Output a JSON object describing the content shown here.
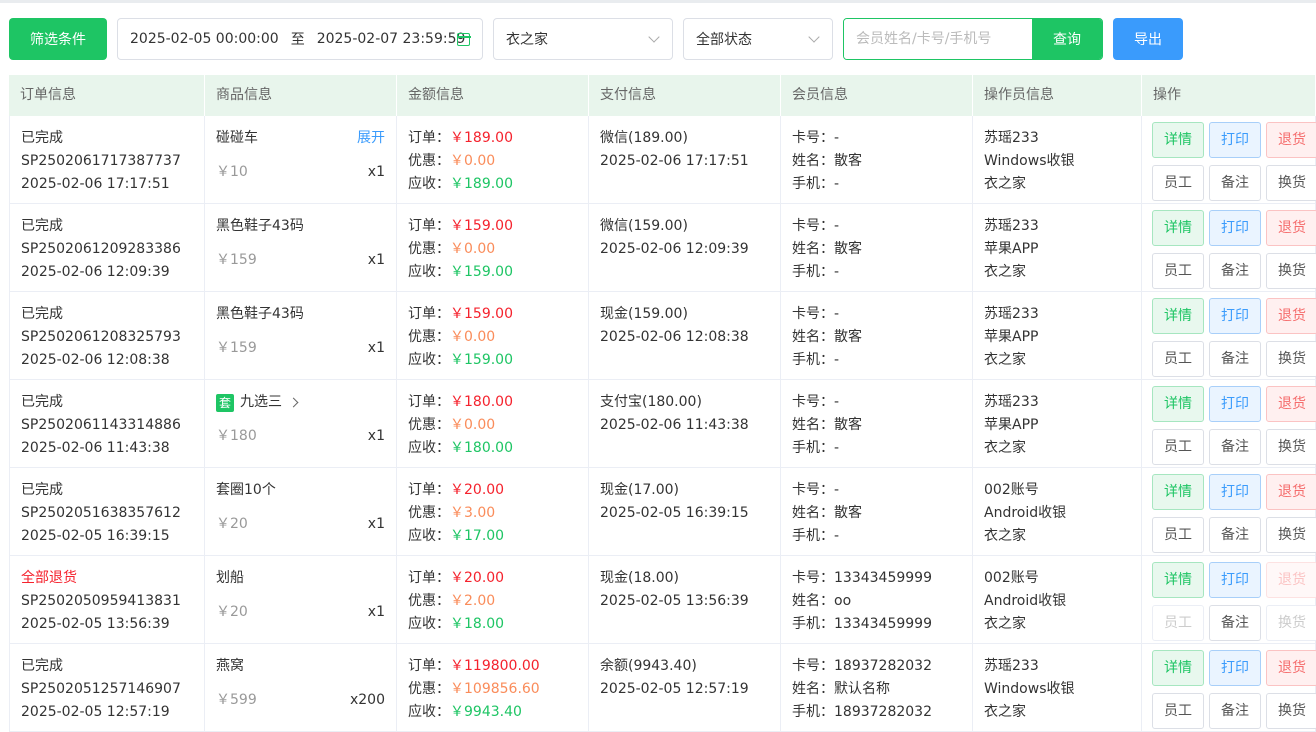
{
  "toolbar": {
    "filter_label": "筛选条件",
    "date_start": "2025-02-05 00:00:00",
    "date_sep": "至",
    "date_end": "2025-02-07 23:59:59",
    "store_value": "衣之家",
    "status_value": "全部状态",
    "search_placeholder": "会员姓名/卡号/手机号",
    "query_label": "查询",
    "export_label": "导出"
  },
  "table": {
    "headers": [
      "订单信息",
      "商品信息",
      "金额信息",
      "支付信息",
      "会员信息",
      "操作员信息",
      "操作"
    ],
    "labels": {
      "order": "订单：",
      "discount": "优惠：",
      "receivable": "应收：",
      "card": "卡号：",
      "name": "姓名：",
      "phone": "手机：",
      "expand": "展开",
      "set_tag": "套",
      "op_detail": "详情",
      "op_print": "打印",
      "op_refund": "退货",
      "op_staff": "员工",
      "op_note": "备注",
      "op_exchange": "换货"
    },
    "rows": [
      {
        "status": "已完成",
        "order_no": "SP2502061717387737",
        "time": "2025-02-06 17:17:51",
        "goods": "碰碰车",
        "price": "￥10",
        "qty": "x1",
        "order_amt": "￥189.00",
        "discount_amt": "￥0.00",
        "recv_amt": "￥189.00",
        "pay_method": "微信(189.00)",
        "pay_time": "2025-02-06 17:17:51",
        "card": "-",
        "name": "散客",
        "phone": "-",
        "operator": "苏瑶233",
        "terminal": "Windows收银",
        "store": "衣之家"
      },
      {
        "status": "已完成",
        "order_no": "SP2502061209283386",
        "time": "2025-02-06 12:09:39",
        "goods": "黑色鞋子43码",
        "price": "￥159",
        "qty": "x1",
        "order_amt": "￥159.00",
        "discount_amt": "￥0.00",
        "recv_amt": "￥159.00",
        "pay_method": "微信(159.00)",
        "pay_time": "2025-02-06 12:09:39",
        "card": "-",
        "name": "散客",
        "phone": "-",
        "operator": "苏瑶233",
        "terminal": "苹果APP",
        "store": "衣之家"
      },
      {
        "status": "已完成",
        "order_no": "SP2502061208325793",
        "time": "2025-02-06 12:08:38",
        "goods": "黑色鞋子43码",
        "price": "￥159",
        "qty": "x1",
        "order_amt": "￥159.00",
        "discount_amt": "￥0.00",
        "recv_amt": "￥159.00",
        "pay_method": "现金(159.00)",
        "pay_time": "2025-02-06 12:08:38",
        "card": "-",
        "name": "散客",
        "phone": "-",
        "operator": "苏瑶233",
        "terminal": "苹果APP",
        "store": "衣之家"
      },
      {
        "status": "已完成",
        "order_no": "SP2502061143314886",
        "time": "2025-02-06 11:43:38",
        "goods": "九选三",
        "price": "￥180",
        "qty": "x1",
        "order_amt": "￥180.00",
        "discount_amt": "￥0.00",
        "recv_amt": "￥180.00",
        "pay_method": "支付宝(180.00)",
        "pay_time": "2025-02-06 11:43:38",
        "card": "-",
        "name": "散客",
        "phone": "-",
        "operator": "苏瑶233",
        "terminal": "苹果APP",
        "store": "衣之家"
      },
      {
        "status": "已完成",
        "order_no": "SP2502051638357612",
        "time": "2025-02-05 16:39:15",
        "goods": "套圈10个",
        "price": "￥20",
        "qty": "x1",
        "order_amt": "￥20.00",
        "discount_amt": "￥3.00",
        "recv_amt": "￥17.00",
        "pay_method": "现金(17.00)",
        "pay_time": "2025-02-05 16:39:15",
        "card": "-",
        "name": "散客",
        "phone": "-",
        "operator": "002账号",
        "terminal": "Android收银",
        "store": "衣之家"
      },
      {
        "status": "全部退货",
        "order_no": "SP2502050959413831",
        "time": "2025-02-05 13:56:39",
        "goods": "划船",
        "price": "￥20",
        "qty": "x1",
        "order_amt": "￥20.00",
        "discount_amt": "￥2.00",
        "recv_amt": "￥18.00",
        "pay_method": "现金(18.00)",
        "pay_time": "2025-02-05 13:56:39",
        "card": "13343459999",
        "name": "oo",
        "phone": "13343459999",
        "operator": "002账号",
        "terminal": "Android收银",
        "store": "衣之家"
      },
      {
        "status": "已完成",
        "order_no": "SP2502051257146907",
        "time": "2025-02-05 12:57:19",
        "goods": "燕窝",
        "price": "￥599",
        "qty": "x200",
        "order_amt": "￥119800.00",
        "discount_amt": "￥109856.60",
        "recv_amt": "￥9943.40",
        "pay_method": "余额(9943.40)",
        "pay_time": "2025-02-05 12:57:19",
        "card": "18937282032",
        "name": "默认名称",
        "phone": "18937282032",
        "operator": "苏瑶233",
        "terminal": "Windows收银",
        "store": "衣之家"
      }
    ]
  }
}
